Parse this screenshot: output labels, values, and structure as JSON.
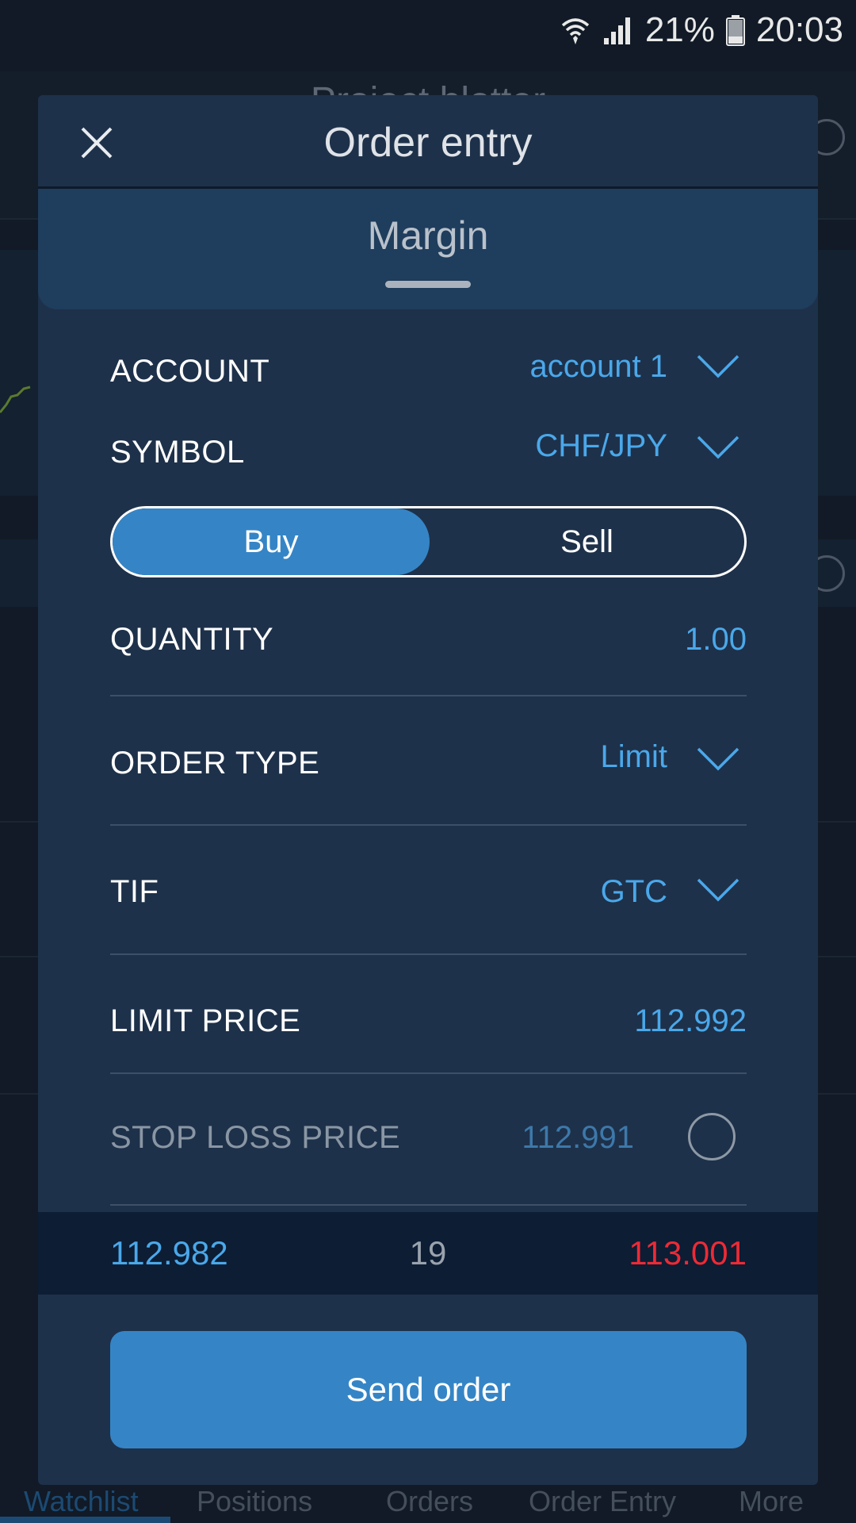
{
  "status_bar": {
    "battery": "21%",
    "time": "20:03"
  },
  "background": {
    "header_title": "Project blotter",
    "tabs": [
      {
        "label": "Watchlist",
        "active": true
      },
      {
        "label": "Positions"
      },
      {
        "label": "Orders"
      },
      {
        "label": "Order Entry"
      },
      {
        "label": "More"
      }
    ]
  },
  "modal": {
    "title": "Order entry",
    "section": "Margin",
    "account": {
      "label": "ACCOUNT",
      "value": "account 1"
    },
    "symbol": {
      "label": "SYMBOL",
      "value": "CHF/JPY"
    },
    "side": {
      "buy": "Buy",
      "sell": "Sell",
      "selected": "Buy"
    },
    "quantity": {
      "label": "QUANTITY",
      "value": "1.00"
    },
    "order_type": {
      "label": "ORDER TYPE",
      "value": "Limit"
    },
    "tif": {
      "label": "TIF",
      "value": "GTC"
    },
    "limit_price": {
      "label": "LIMIT PRICE",
      "value": "112.992"
    },
    "stop_loss": {
      "label": "STOP LOSS PRICE",
      "value": "112.991",
      "enabled": false
    },
    "quote": {
      "bid": "112.982",
      "spread": "19",
      "ask": "113.001"
    },
    "send_button": "Send order"
  },
  "colors": {
    "accent": "#3585c6",
    "value_blue": "#4aa8ea",
    "ask_red": "#ee2a35",
    "modal_bg": "#1e314a"
  }
}
